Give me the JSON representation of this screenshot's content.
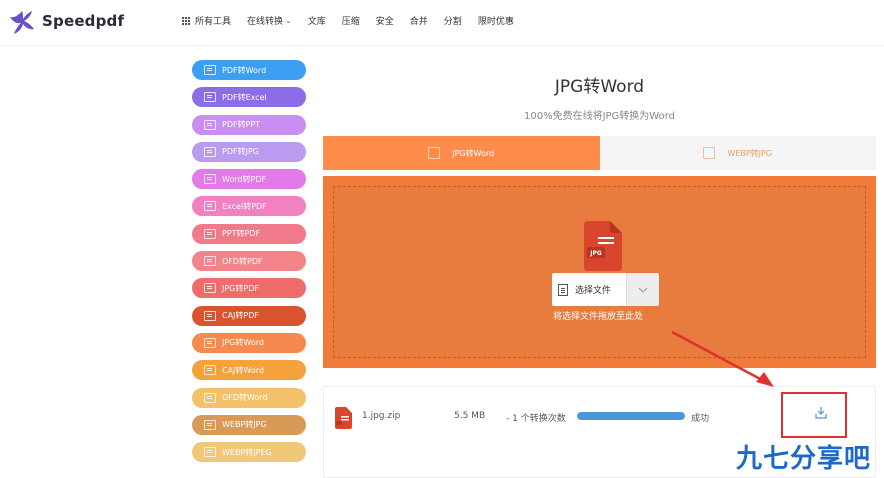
{
  "header": {
    "brand": "Speedpdf",
    "nav": [
      {
        "label": "所有工具",
        "has_grid": true,
        "has_chevron": false
      },
      {
        "label": "在线转换",
        "has_grid": false,
        "has_chevron": true
      },
      {
        "label": "文库"
      },
      {
        "label": "压缩"
      },
      {
        "label": "安全"
      },
      {
        "label": "合并"
      },
      {
        "label": "分割"
      },
      {
        "label": "限时优惠"
      }
    ]
  },
  "sidebar": {
    "items": [
      {
        "label": "PDF转Word",
        "color": "#3d9ff2"
      },
      {
        "label": "PDF转Excel",
        "color": "#8b6de8"
      },
      {
        "label": "PDF转PPT",
        "color": "#c88ef2"
      },
      {
        "label": "PDF转JPG",
        "color": "#b99cf0"
      },
      {
        "label": "Word转PDF",
        "color": "#e27ae8"
      },
      {
        "label": "Excel转PDF",
        "color": "#f082c2"
      },
      {
        "label": "PPT转PDF",
        "color": "#f07a8a"
      },
      {
        "label": "OFD转PDF",
        "color": "#f2848a"
      },
      {
        "label": "JPG转PDF",
        "color": "#f06c6a"
      },
      {
        "label": "CAJ转PDF",
        "color": "#d9542c"
      },
      {
        "label": "JPG转Word",
        "color": "#f58a4e"
      },
      {
        "label": "CAJ转Word",
        "color": "#f5a23c"
      },
      {
        "label": "OFD转Word",
        "color": "#f5c06a"
      },
      {
        "label": "WEBP转JPG",
        "color": "#d99a58"
      },
      {
        "label": "WEBP转JPEG",
        "color": "#f0c878"
      }
    ]
  },
  "main": {
    "title": "JPG转Word",
    "subtitle": "100%免费在线将JPG转换为Word",
    "tabs": [
      {
        "label": "JPG转Word",
        "active": true
      },
      {
        "label": "WEBP转JPG",
        "active": false
      }
    ],
    "upload": {
      "file_badge": "JPG",
      "choose_label": "选择文件",
      "hint": "将选择文件拖放至此处"
    },
    "file": {
      "name": "1.jpg.zip",
      "size": "5.5 MB",
      "count": "- 1 个转换次数",
      "progress": 1.0,
      "status": "成功"
    }
  },
  "watermark": "九七分享吧",
  "colors": {
    "accent": "#ff8c4a",
    "upload_bg": "#f07b3a",
    "progress": "#4d95d9",
    "highlight": "#e0322c"
  }
}
